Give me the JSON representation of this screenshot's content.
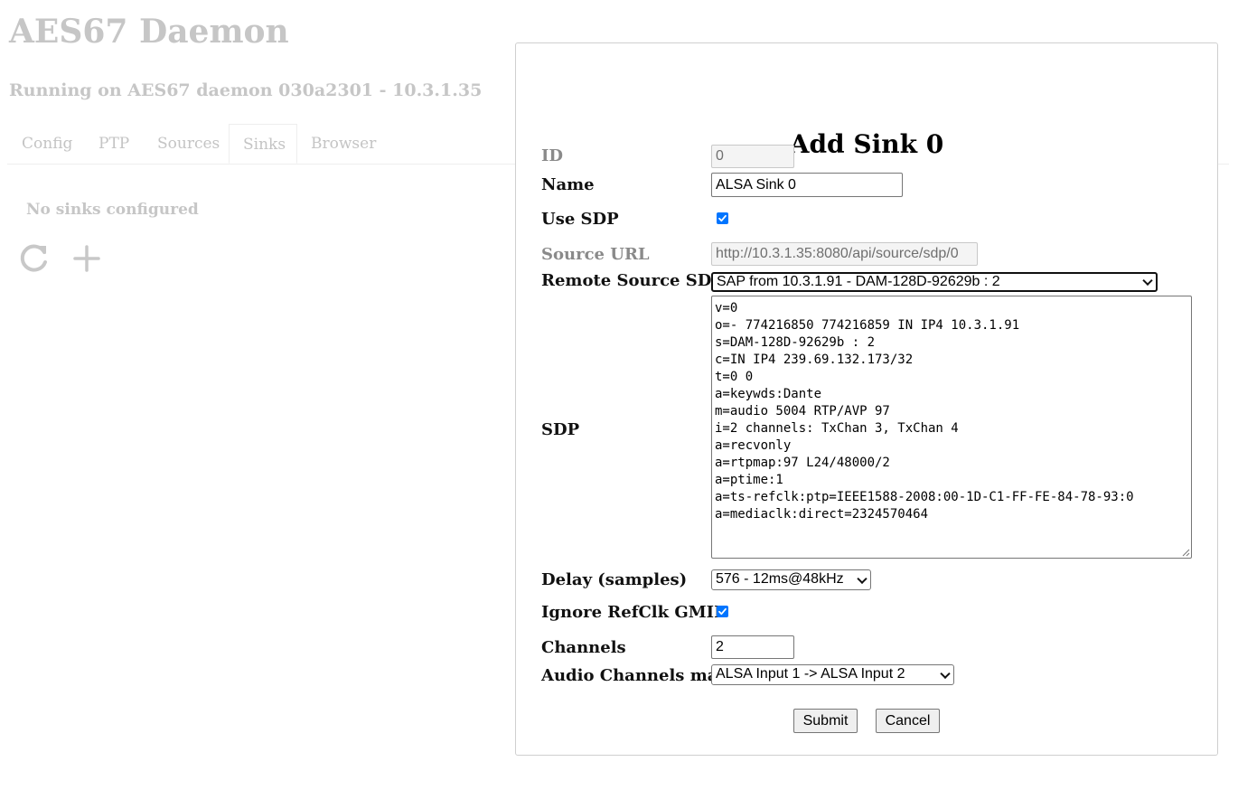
{
  "app": {
    "title": "AES67 Daemon",
    "subtitle": "Running on AES67 daemon 030a2301 - 10.3.1.35"
  },
  "tabs": [
    {
      "label": "Config",
      "active": false
    },
    {
      "label": "PTP",
      "active": false
    },
    {
      "label": "Sources",
      "active": false
    },
    {
      "label": "Sinks",
      "active": true
    },
    {
      "label": "Browser",
      "active": false
    }
  ],
  "sinks_panel": {
    "empty_text": "No sinks configured",
    "icons": [
      "refresh-icon",
      "add-icon"
    ]
  },
  "modal": {
    "title": "Add Sink 0",
    "id": {
      "label": "ID",
      "value": "0"
    },
    "name": {
      "label": "Name",
      "value": "ALSA Sink 0"
    },
    "use_sdp": {
      "label": "Use SDP",
      "checked": true
    },
    "source_url": {
      "label": "Source URL",
      "value": "http://10.3.1.35:8080/api/source/sdp/0"
    },
    "remote_source": {
      "label": "Remote Source SDP",
      "selected": "SAP from 10.3.1.91 - DAM-128D-92629b : 2"
    },
    "sdp": {
      "label": "SDP",
      "lines": [
        "v=0",
        "o=- 774216850 774216859 IN IP4 10.3.1.91",
        "s=DAM-128D-92629b : 2",
        "c=IN IP4 239.69.132.173/32",
        "t=0 0",
        "a=keywds:Dante",
        "m=audio 5004 RTP/AVP 97",
        "i=2 channels: TxChan 3, TxChan 4",
        "a=recvonly",
        "a=rtpmap:97 L24/48000/2",
        "a=ptime:1",
        "a=ts-refclk:ptp=IEEE1588-2008:00-1D-C1-FF-FE-84-78-93:0",
        "a=mediaclk:direct=2324570464"
      ]
    },
    "delay": {
      "label": "Delay (samples)",
      "selected": "576 - 12ms@48kHz"
    },
    "ignore_refclk": {
      "label": "Ignore RefClk GMID",
      "checked": true
    },
    "channels": {
      "label": "Channels",
      "value": "2"
    },
    "channel_map": {
      "label": "Audio Channels map",
      "selected": "ALSA Input 1 -> ALSA Input 2"
    },
    "submit_label": "Submit",
    "cancel_label": "Cancel"
  },
  "colors": {
    "checkbox_accent": "#0075ff"
  }
}
